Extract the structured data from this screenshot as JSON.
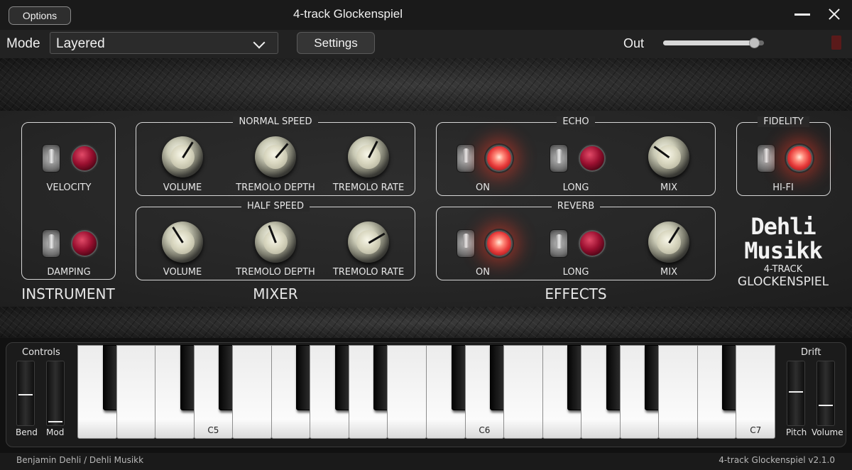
{
  "window": {
    "title": "4-track Glockenspiel",
    "options_label": "Options"
  },
  "toolbar": {
    "mode_label": "Mode",
    "mode_value": "Layered",
    "settings_label": "Settings",
    "out_label": "Out",
    "out_level": 0.9
  },
  "instrument": {
    "section_label": "INSTRUMENT",
    "velocity_label": "VELOCITY",
    "velocity_on": false,
    "damping_label": "DAMPING",
    "damping_on": false
  },
  "mixer": {
    "section_label": "MIXER",
    "normal": {
      "title": "NORMAL SPEED",
      "volume_label": "VOLUME",
      "volume_value": 0.62,
      "tremolo_depth_label": "TREMOLO DEPTH",
      "tremolo_depth_value": 0.65,
      "tremolo_rate_label": "TREMOLO RATE",
      "tremolo_rate_value": 0.6
    },
    "half": {
      "title": "HALF SPEED",
      "volume_label": "VOLUME",
      "volume_value": 0.38,
      "tremolo_depth_label": "TREMOLO DEPTH",
      "tremolo_depth_value": 0.42,
      "tremolo_rate_label": "TREMOLO RATE",
      "tremolo_rate_value": 0.72
    }
  },
  "effects": {
    "section_label": "EFFECTS",
    "echo": {
      "title": "ECHO",
      "on_label": "ON",
      "on": true,
      "long_label": "LONG",
      "long": false,
      "mix_label": "MIX",
      "mix_value": 0.3
    },
    "reverb": {
      "title": "REVERB",
      "on_label": "ON",
      "on": true,
      "long_label": "LONG",
      "long": false,
      "mix_label": "MIX",
      "mix_value": 0.62
    }
  },
  "fidelity": {
    "title": "FIDELITY",
    "hifi_label": "HI-FI",
    "hifi_on": true
  },
  "brand": {
    "logo_line1": "Dehli",
    "logo_line2": "Musikk",
    "sub1": "4-TRACK",
    "sub2": "GLOCKENSPIEL"
  },
  "keyboard": {
    "controls_label": "Controls",
    "bend_label": "Bend",
    "bend_value": 0.5,
    "mod_label": "Mod",
    "mod_value": 0.0,
    "drift_label": "Drift",
    "pitch_label": "Pitch",
    "pitch_value": 0.55,
    "volume_label": "Volume",
    "volume_value": 0.3,
    "key_labels": {
      "3": "C5",
      "10": "C6",
      "17": "C7"
    }
  },
  "footer": {
    "author": "Benjamin Dehli  /  Dehli Musikk",
    "version": "4-track Glockenspiel  v2.1.0"
  },
  "colors": {
    "panel": "#262626",
    "led_lit": "#e63a3a",
    "led_off": "#9a1030",
    "outline": "#d6d6d6"
  }
}
